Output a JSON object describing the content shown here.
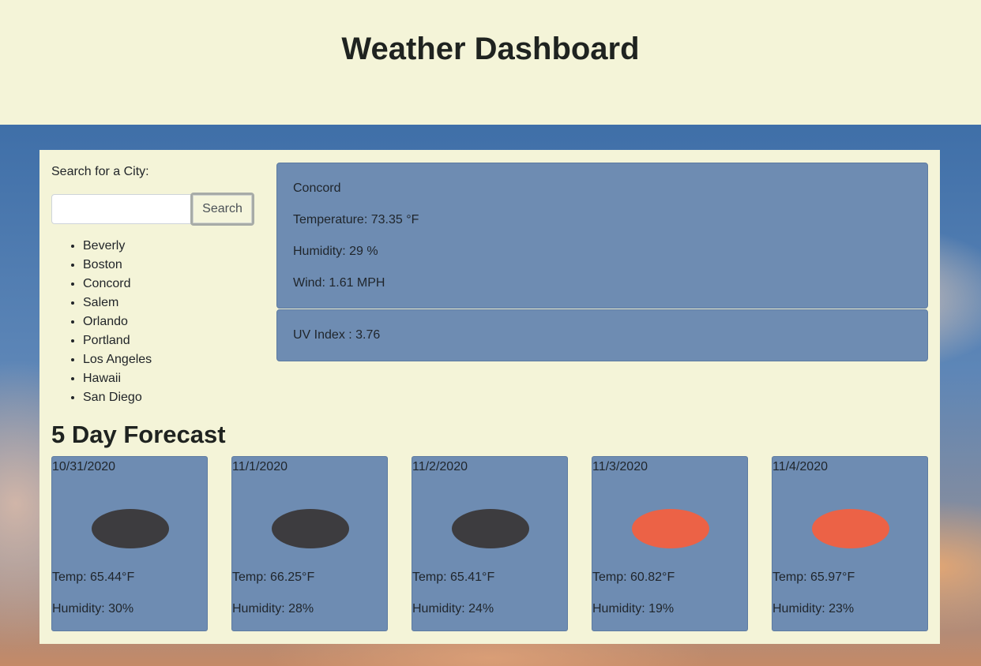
{
  "header": {
    "title": "Weather Dashboard"
  },
  "search": {
    "label": "Search for a City:",
    "input_value": "",
    "button_label": "Search"
  },
  "history": [
    "Beverly",
    "Boston",
    "Concord",
    "Salem",
    "Orlando",
    "Portland",
    "Los Angeles",
    "Hawaii",
    "San Diego"
  ],
  "current": {
    "city": "Concord",
    "temperature": "Temperature: 73.35 °F",
    "humidity": "Humidity: 29 %",
    "wind": "Wind: 1.61 MPH",
    "uv": "UV Index : 3.76"
  },
  "forecast": {
    "title": "5 Day Forecast",
    "days": [
      {
        "date": "10/31/2020",
        "icon": "dark-cloud-icon",
        "icon_color": "#3d3c3f",
        "temp": "Temp: 65.44°F",
        "humidity": "Humidity: 30%"
      },
      {
        "date": "11/1/2020",
        "icon": "dark-cloud-icon",
        "icon_color": "#3d3c3f",
        "temp": "Temp: 66.25°F",
        "humidity": "Humidity: 28%"
      },
      {
        "date": "11/2/2020",
        "icon": "dark-cloud-icon",
        "icon_color": "#3d3c3f",
        "temp": "Temp: 65.41°F",
        "humidity": "Humidity: 24%"
      },
      {
        "date": "11/3/2020",
        "icon": "sun-icon",
        "icon_color": "#ec6246",
        "temp": "Temp: 60.82°F",
        "humidity": "Humidity: 19%"
      },
      {
        "date": "11/4/2020",
        "icon": "sun-icon",
        "icon_color": "#ec6246",
        "temp": "Temp: 65.97°F",
        "humidity": "Humidity: 23%"
      }
    ]
  },
  "colors": {
    "card_bg": "#6e8cb2",
    "page_bg": "#f4f4d8"
  }
}
